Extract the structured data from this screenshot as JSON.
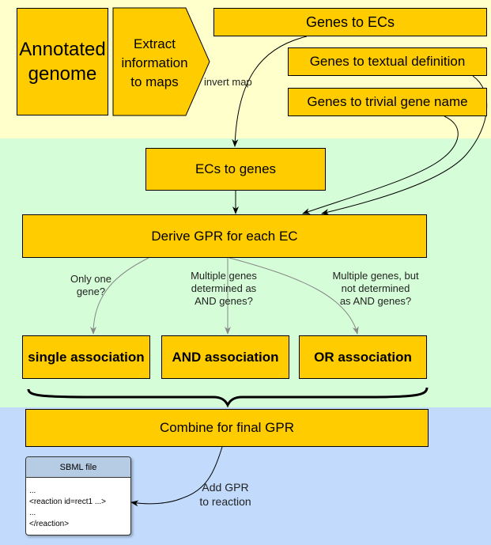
{
  "colors": {
    "band_extract": "#ffffcc",
    "band_derive": "#d5fdd7",
    "band_output": "#c2dbfc",
    "process_box": "#ffcc00",
    "sbml_header": "#b6cbe4"
  },
  "nodes": {
    "annotated_genome": "Annotated genome",
    "extract_info": [
      "Extract",
      "information",
      "to maps"
    ],
    "genes_to_ecs": "Genes to ECs",
    "genes_to_textual": "Genes to textual definition",
    "genes_to_trivial": "Genes to trivial gene name",
    "ecs_to_genes": "ECs to genes",
    "derive_gpr": "Derive GPR for each EC",
    "single_association": "single association",
    "and_association": "AND association",
    "or_association": "OR association",
    "combine_final": "Combine for final GPR"
  },
  "edge_labels": {
    "invert_map": "invert map",
    "only_one_gene": [
      "Only one",
      "gene?"
    ],
    "multiple_and": [
      "Multiple genes",
      "determined as",
      "AND genes?"
    ],
    "multiple_not_and": [
      "Multiple genes, but",
      "not determined",
      "as AND genes?"
    ],
    "add_gpr": [
      "Add GPR",
      "to reaction"
    ]
  },
  "sbml_file": {
    "title": "SBML file",
    "lines": [
      "...",
      "<reaction id=rect1 ...>",
      "...",
      "</reaction>"
    ]
  }
}
